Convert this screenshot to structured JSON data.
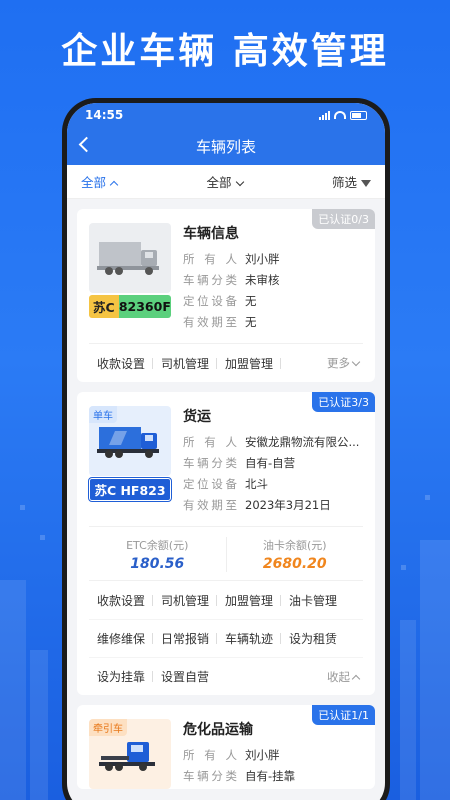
{
  "headline": "企业车辆 高效管理",
  "status": {
    "time": "14:55"
  },
  "nav": {
    "title": "车辆列表"
  },
  "filters": {
    "f1": "全部",
    "f2": "全部",
    "f3": "筛选"
  },
  "cards": [
    {
      "badge": "已认证0/3",
      "title": "车辆信息",
      "plate_prefix": "苏C",
      "plate_number": "82360F",
      "fields": [
        {
          "k": "所有人",
          "v": "刘小胖"
        },
        {
          "k": "车辆分类",
          "v": "未审核"
        },
        {
          "k": "定位设备",
          "v": "无"
        },
        {
          "k": "有效期至",
          "v": "无"
        }
      ],
      "actions": [
        "收款设置",
        "司机管理",
        "加盟管理"
      ],
      "more": "更多"
    },
    {
      "badge": "已认证3/3",
      "tag": "单车",
      "title": "货运",
      "plate": "苏C HF823",
      "fields": [
        {
          "k": "所有人",
          "v": "安徽龙鼎物流有限公..."
        },
        {
          "k": "车辆分类",
          "v": "自有-自营"
        },
        {
          "k": "定位设备",
          "v": "北斗"
        },
        {
          "k": "有效期至",
          "v": "2023年3月21日"
        }
      ],
      "etc_label": "ETC余额(元)",
      "etc_value": "180.56",
      "oil_label": "油卡余额(元)",
      "oil_value": "2680.20",
      "actions_row1": [
        "收款设置",
        "司机管理",
        "加盟管理",
        "油卡管理"
      ],
      "actions_row2": [
        "维修维保",
        "日常报销",
        "车辆轨迹",
        "设为租赁"
      ],
      "actions_row3": [
        "设为挂靠",
        "设置自营"
      ],
      "collapse": "收起"
    },
    {
      "badge": "已认证1/1",
      "tag": "牵引车",
      "title": "危化品运输",
      "fields": [
        {
          "k": "所有人",
          "v": "刘小胖"
        },
        {
          "k": "车辆分类",
          "v": "自有-挂靠"
        }
      ]
    }
  ],
  "colors": {
    "primary": "#2a73ea",
    "orange": "#f0861e",
    "plate_yellow": "#f5c443",
    "plate_green": "#5bd07d"
  }
}
